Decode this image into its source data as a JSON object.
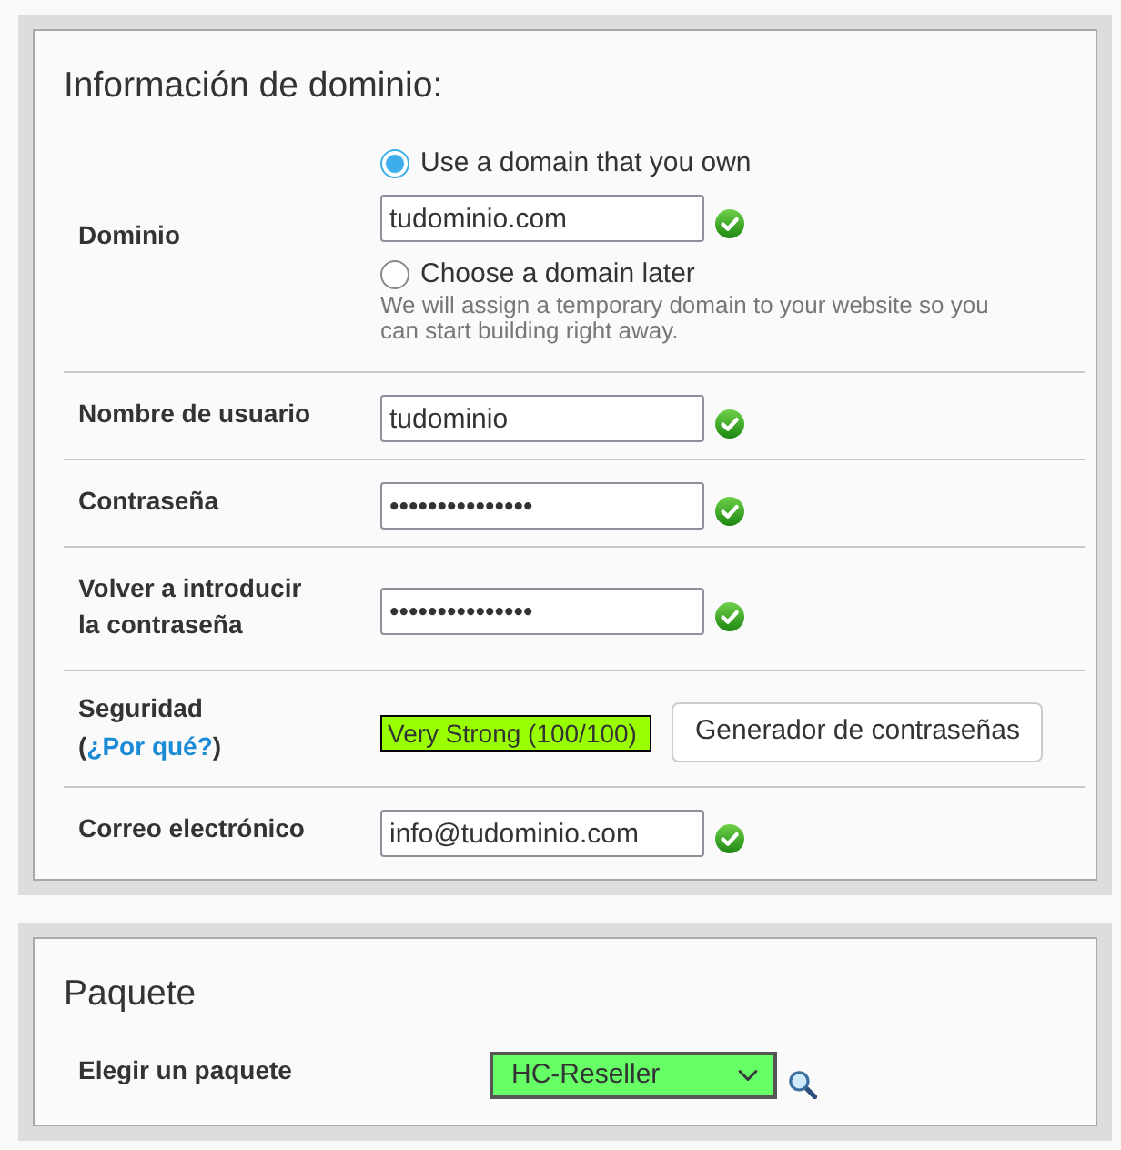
{
  "domain_panel": {
    "title": "Información de dominio:",
    "rows": [
      {
        "kind": "domain",
        "label": "Dominio",
        "options": [
          {
            "label": "Use a domain that you own",
            "selected": true,
            "field": {
              "value": "tudominio.com",
              "valid": true
            }
          },
          {
            "label": "Choose a domain later",
            "selected": false,
            "help": "We will assign a temporary domain to your website so you can start building right away."
          }
        ]
      },
      {
        "kind": "field",
        "label": "Nombre de usuario",
        "value": "tudominio",
        "valid": true
      },
      {
        "kind": "field",
        "label": "Contraseña",
        "value": "•••••••••••••••",
        "valid": true
      },
      {
        "kind": "field",
        "label": "Volver a introducir la contraseña",
        "value": "•••••••••••••••",
        "valid": true
      },
      {
        "kind": "strength",
        "label": "Seguridad",
        "note_open": "(",
        "link": "¿Por qué?",
        "note_close": ")",
        "meter": {
          "text": "Very Strong (100/100)",
          "level": 1
        },
        "button": "Generador de contraseñas"
      },
      {
        "kind": "field",
        "label": "Correo electrónico",
        "value": "info@tudominio.com",
        "valid": true
      }
    ]
  },
  "package_panel": {
    "title": "Paquete",
    "label": "Elegir un paquete",
    "value": "HC-Reseller"
  }
}
